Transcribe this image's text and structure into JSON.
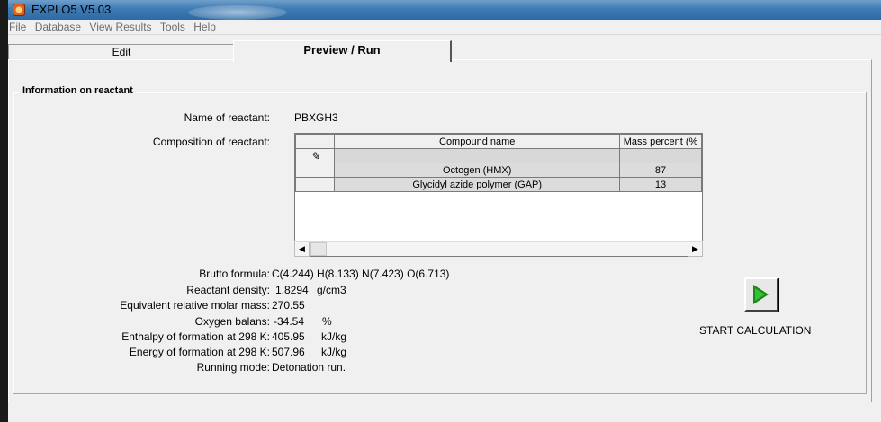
{
  "window": {
    "title": "EXPLO5 V5.03"
  },
  "menu": [
    "File",
    "Database",
    "View Results",
    "Tools",
    "Help"
  ],
  "tabs": {
    "edit": "Edit",
    "run": "Preview / Run"
  },
  "group": {
    "title": "Information on reactant"
  },
  "reactant": {
    "name_label": "Name of reactant:",
    "name": "PBXGH3",
    "composition_label": "Composition of reactant:"
  },
  "grid": {
    "col_name": "Compound name",
    "col_mass": "Mass percent (%",
    "rows": [
      {
        "name": "Octogen (HMX)",
        "mass": "87"
      },
      {
        "name": "Glycidyl azide polymer (GAP)",
        "mass": "13"
      }
    ]
  },
  "props": {
    "brutto_label": "Brutto formula:",
    "brutto": "C(4.244) H(8.133) N(7.423) O(6.713)",
    "density_label": "Reactant density:",
    "density": "1.8294",
    "density_unit": "g/cm3",
    "molar_label": "Equivalent relative molar mass:",
    "molar": "270.55",
    "oxygen_label": "Oxygen balans:",
    "oxygen": "-34.54",
    "oxygen_unit": "%",
    "enthalpy_label": "Enthalpy of formation at 298 K:",
    "enthalpy": "405.95",
    "enthalpy_unit": "kJ/kg",
    "energy_label": "Energy of formation at 298 K:",
    "energy": "507.96",
    "energy_unit": "kJ/kg",
    "mode_label": "Running mode:",
    "mode": "Detonation run."
  },
  "start": {
    "label": "START CALCULATION"
  },
  "colors": {
    "titlebar": "#3f7bb4",
    "play": "#1a8a1a"
  }
}
